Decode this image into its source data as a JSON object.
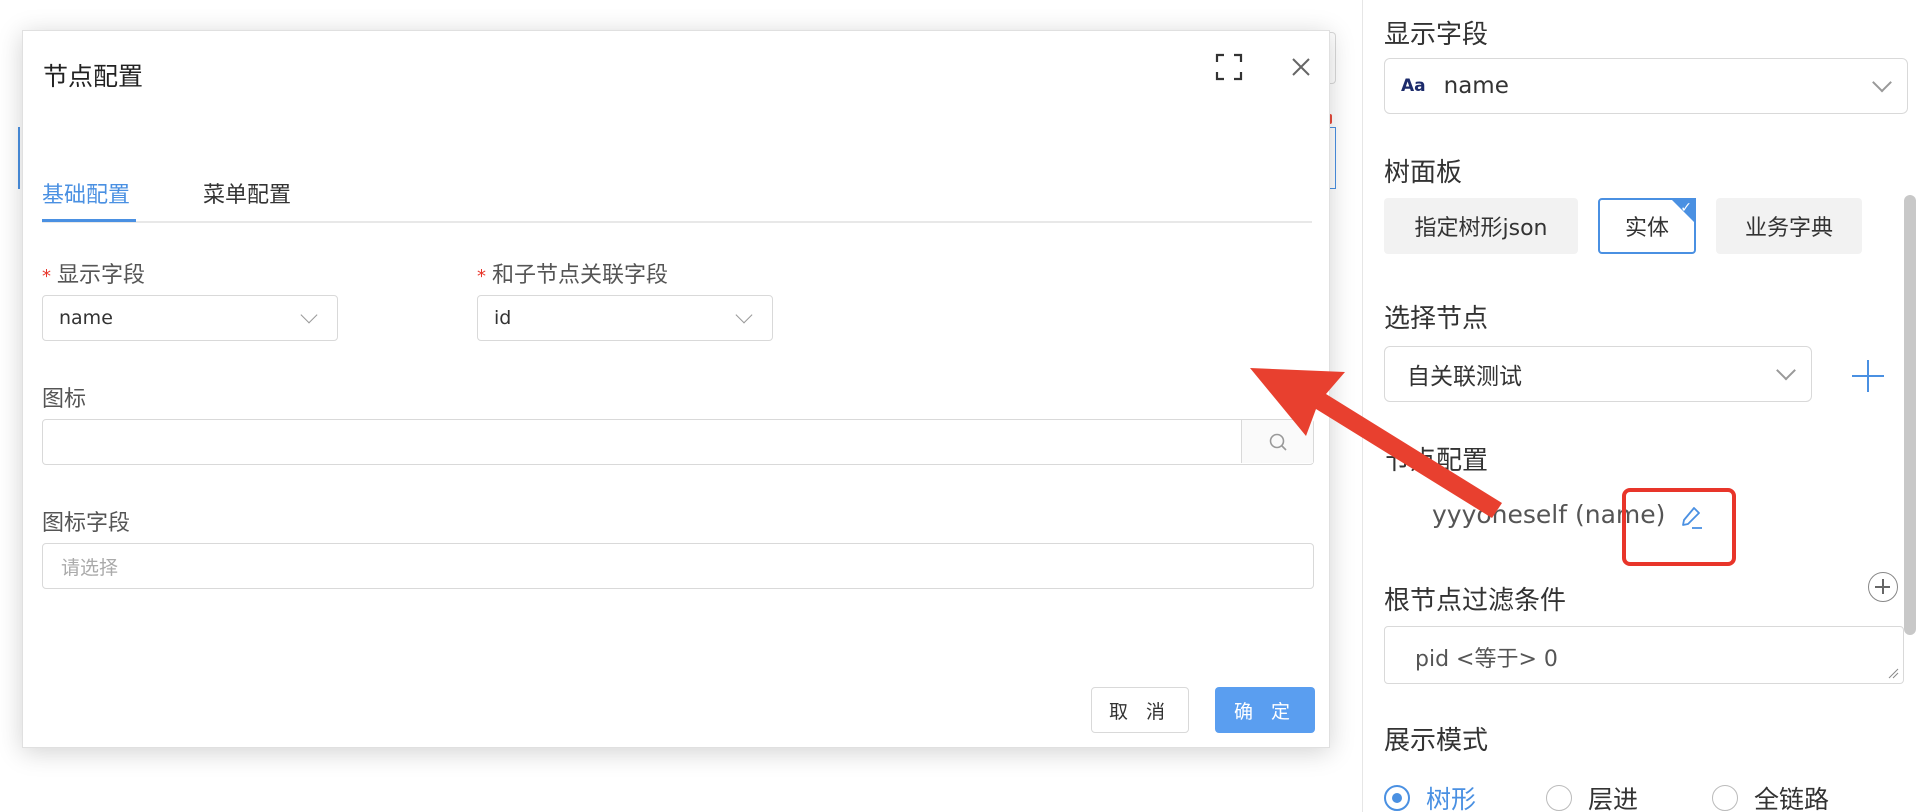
{
  "modal": {
    "title": "节点配置",
    "tabs": [
      {
        "label": "基础配置",
        "active": true
      },
      {
        "label": "菜单配置",
        "active": false
      }
    ],
    "fields": {
      "display_field": {
        "label": "显示字段",
        "value": "name",
        "required": true
      },
      "relation_field": {
        "label": "和子节点关联字段",
        "value": "id",
        "required": true
      },
      "icon": {
        "label": "图标",
        "value": ""
      },
      "icon_field": {
        "label": "图标字段",
        "placeholder": "请选择"
      }
    },
    "buttons": {
      "cancel": "取 消",
      "ok": "确 定"
    },
    "required_mark": "*"
  },
  "right_panel": {
    "display_field": {
      "label": "显示字段",
      "type_badge": "Aa",
      "value": "name"
    },
    "tree_panel": {
      "label": "树面板",
      "options": [
        {
          "label": "指定树形json",
          "active": false
        },
        {
          "label": "实体",
          "active": true
        },
        {
          "label": "业务字典",
          "active": false
        }
      ]
    },
    "select_node": {
      "label": "选择节点",
      "value": "自关联测试"
    },
    "node_config": {
      "label": "节点配置",
      "item": "yyyoneself (name)"
    },
    "root_filter": {
      "label": "根节点过滤条件",
      "value": "pid <等于> 0"
    },
    "display_mode": {
      "label": "展示模式",
      "options": [
        {
          "label": "树形",
          "selected": true
        },
        {
          "label": "层进",
          "selected": false
        },
        {
          "label": "全链路",
          "selected": false
        }
      ]
    }
  },
  "colors": {
    "accent": "#4a90e2",
    "highlight_red": "#e8352a",
    "primary_button": "#5a9ef0"
  }
}
